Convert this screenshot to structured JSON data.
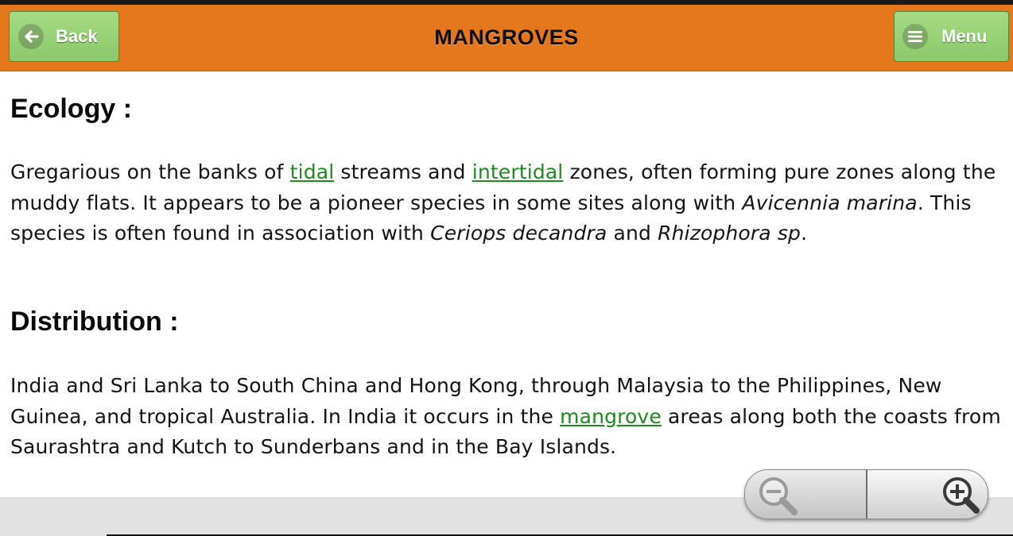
{
  "header": {
    "title": "MANGROVES",
    "back_label": "Back",
    "menu_label": "Menu",
    "colors": {
      "bar": "#e5781c",
      "button": "#8bc96a",
      "link": "#1f8a1f"
    }
  },
  "ecology": {
    "heading": "Ecology :",
    "text_1": "Gregarious on the banks of ",
    "link_tidal": "tidal",
    "text_2": " streams and ",
    "link_intertidal": "intertidal",
    "text_3": " zones, often forming pure zones along the muddy flats. It appears to be a pioneer species in some sites along with ",
    "species_1": "Avicennia marina",
    "text_4": ". This species is often found in association with ",
    "species_2": "Ceriops decandra",
    "text_5": " and ",
    "species_3": "Rhizophora sp",
    "text_6": "."
  },
  "distribution": {
    "heading": "Distribution :",
    "text_1": "India and Sri Lanka to South China and Hong Kong, through Malaysia to the Philippines, New Guinea, and tropical Australia. In India it occurs in the ",
    "link_mangrove": "mangrove",
    "text_2": " areas along both the coasts from Saurashtra and Kutch to Sunderbans and in the Bay Islands."
  },
  "zoom_controls": {
    "zoom_out_icon": "zoom-out-icon",
    "zoom_in_icon": "zoom-in-icon",
    "zoom_out_enabled": false
  }
}
